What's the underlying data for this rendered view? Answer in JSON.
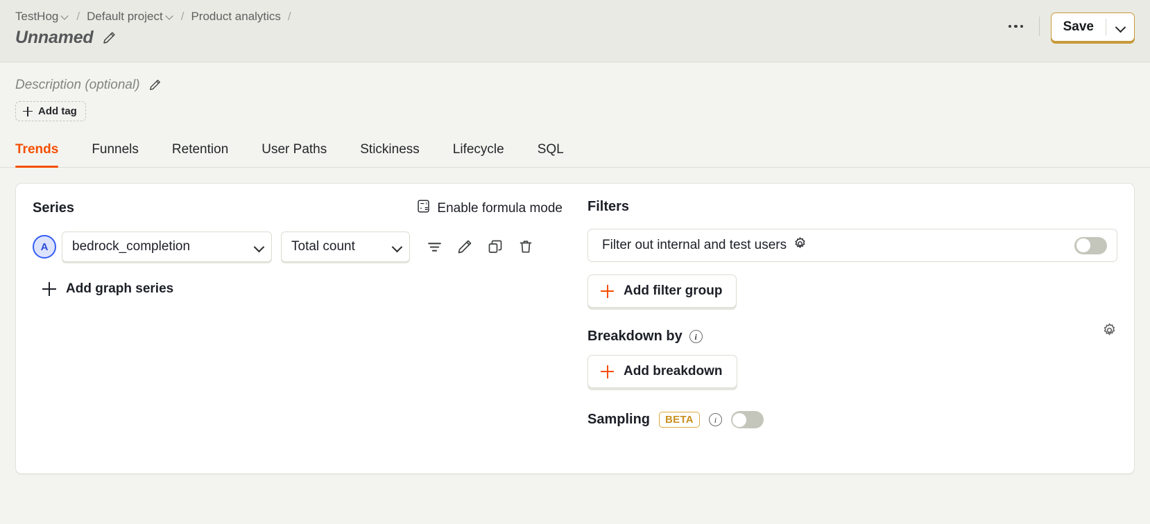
{
  "breadcrumb": {
    "items": [
      {
        "label": "TestHog",
        "has_chevron": true
      },
      {
        "label": "Default project",
        "has_chevron": true
      },
      {
        "label": "Product analytics",
        "has_chevron": false
      }
    ],
    "separator": "/"
  },
  "header": {
    "title": "Unnamed",
    "edit_icon": "pencil-icon",
    "more_icon": "ellipsis-icon",
    "save_label": "Save",
    "save_caret_icon": "chevron-down-icon",
    "save_border_color": "#c79a3a"
  },
  "meta": {
    "description_placeholder": "Description (optional)",
    "description_edit_icon": "pencil-icon",
    "add_tag_label": "Add tag",
    "add_tag_icon": "plus-icon"
  },
  "tabs": {
    "active": "Trends",
    "active_color": "#f54e00",
    "items": [
      {
        "label": "Trends"
      },
      {
        "label": "Funnels"
      },
      {
        "label": "Retention"
      },
      {
        "label": "User Paths"
      },
      {
        "label": "Stickiness"
      },
      {
        "label": "Lifecycle"
      },
      {
        "label": "SQL"
      }
    ]
  },
  "series": {
    "heading": "Series",
    "formula_mode_label": "Enable formula mode",
    "formula_mode_icon": "calculator-icon",
    "rows": [
      {
        "badge": "A",
        "badge_color": "#345cf5",
        "event": "bedrock_completion",
        "event_caret_icon": "chevron-down-icon",
        "math": "Total count",
        "math_caret_icon": "chevron-down-icon",
        "actions": [
          {
            "icon": "filter-icon"
          },
          {
            "icon": "pencil-icon"
          },
          {
            "icon": "duplicate-icon"
          },
          {
            "icon": "trash-icon"
          }
        ]
      }
    ],
    "add_series_label": "Add graph series",
    "add_series_icon": "plus-icon"
  },
  "filters": {
    "heading": "Filters",
    "internal_users_label": "Filter out internal and test users",
    "internal_users_gear_icon": "gear-icon",
    "internal_users_toggle_on": false,
    "add_filter_group_label": "Add filter group",
    "add_filter_group_icon": "plus-icon"
  },
  "breakdown": {
    "heading": "Breakdown by",
    "info_icon": "info-icon",
    "add_breakdown_label": "Add breakdown",
    "add_breakdown_icon": "plus-icon",
    "settings_icon": "gear-icon"
  },
  "sampling": {
    "label": "Sampling",
    "badge": "BETA",
    "badge_color": "#c8901f",
    "info_icon": "info-icon",
    "toggle_on": false
  }
}
